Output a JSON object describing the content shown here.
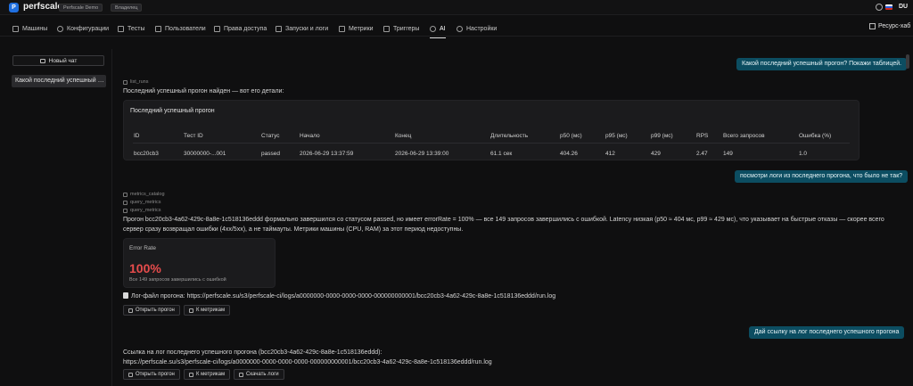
{
  "topbar": {
    "logo_letter": "P",
    "brand": "perfscale",
    "demo_chip": "Perfscale Demo",
    "role_chip": "Владелец",
    "avatar": "DU"
  },
  "nav": {
    "items": [
      {
        "label": "Машины",
        "icon": "server-icon"
      },
      {
        "label": "Конфигурации",
        "icon": "gear-icon"
      },
      {
        "label": "Тесты",
        "icon": "play-icon"
      },
      {
        "label": "Пользователи",
        "icon": "users-icon"
      },
      {
        "label": "Права доступа",
        "icon": "lock-icon"
      },
      {
        "label": "Запуски и логи",
        "icon": "folder-icon"
      },
      {
        "label": "Метрики",
        "icon": "chart-icon"
      },
      {
        "label": "Триггеры",
        "icon": "trigger-icon"
      },
      {
        "label": "AI",
        "icon": "sparkle-icon"
      },
      {
        "label": "Настройки",
        "icon": "settings-icon"
      }
    ],
    "active": "AI",
    "resource_hub": "Ресурс-хаб"
  },
  "sidebar": {
    "new_chat": "Новый чат",
    "chats": [
      "Какой последний успешный прогон? Покажи таблицей."
    ]
  },
  "chat": {
    "msg1_user": "Какой последний успешный прогон? Покажи таблицей.",
    "msg1_tool": "list_runs",
    "msg1_reply": "Последний успешный прогон найден — вот его детали:",
    "table": {
      "title": "Последний успешный прогон",
      "headers": [
        "ID",
        "Тест ID",
        "Статус",
        "Начало",
        "Конец",
        "Длительность",
        "p50 (мс)",
        "p95 (мс)",
        "p99 (мс)",
        "RPS",
        "Всего запросов",
        "Ошибка (%)"
      ],
      "row": [
        "bcc20cb3",
        "30000000-...001",
        "passed",
        "2026-06-29 13:37:59",
        "2026-06-29 13:39:00",
        "61.1 сек",
        "404.26",
        "412",
        "429",
        "2.47",
        "149",
        "1.0"
      ]
    },
    "msg2_user": "посмотри логи из последнего прогона, что было не так?",
    "msg2_tools": [
      "metrics_catalog",
      "query_metrics",
      "query_metrics"
    ],
    "msg2_reply_line1": "Прогон bcc20cb3-4a62-429c-8a8e-1c518136eddd формально завершился со статусом passed, но имеет errorRate = 100% — все 149 запросов завершились с ошибкой. Latency низкая (p50 ≈ 404 мс, p99 ≈ 429 мс), что указывает на быстрые отказы — скорее всего",
    "msg2_reply_line2": "сервер сразу возвращал ошибки (4xx/5xx), а не таймауты. Метрики машины (CPU, RAM) за этот период недоступны.",
    "metric": {
      "label": "Error Rate",
      "value": "100%",
      "sub": "Все 149 запросов завершились с ошибкой"
    },
    "log_line": "Лог-файл прогона: https://perfscale.su/s3/perfscale-ci/logs/a0000000-0000-0000-0000-000000000001/bcc20cb3-4a62-429c-8a8e-1c518136eddd/run.log",
    "btn_open_run": "Открыть прогон",
    "btn_metrics": "К метрикам",
    "msg3_user": "Дай ссылку на лог последнего успешного прогона",
    "msg3_reply_line1": "Ссылка на лог последнего успешного прогона (bcc20cb3-4a62-429c-8a8e-1c518136eddd):",
    "msg3_reply_line2": "https://perfscale.su/s3/perfscale-ci/logs/a0000000-0000-0000-0000-000000000001/bcc20cb3-4a62-429c-8a8e-1c518136eddd/run.log",
    "btn_download": "Скачать логи"
  },
  "colors": {
    "accent_user_bubble": "#0c4d61",
    "error_red": "#e74c4c",
    "logo_blue": "#1f6fe0"
  }
}
